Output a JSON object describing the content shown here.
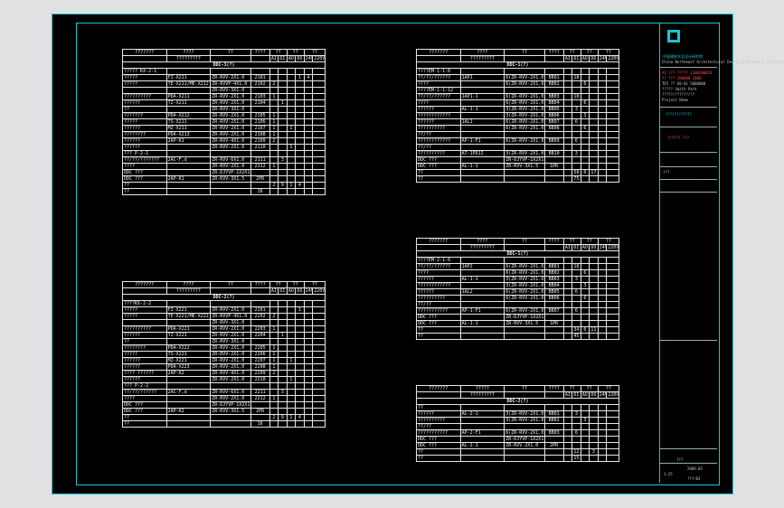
{
  "tables": [
    {
      "id": "ddc-3",
      "header": [
        "???????",
        "????",
        "??",
        "????",
        "??",
        "??",
        "??"
      ],
      "subheader": [
        "",
        "?????????",
        "",
        "",
        "AI",
        "DI",
        "AO",
        "DO",
        "24V",
        "220V"
      ],
      "section": "DDC-3(?)",
      "rows": [
        [
          "????? KX-2-1",
          "",
          "",
          "",
          "",
          "",
          "",
          "",
          "",
          ""
        ],
        [
          "?????",
          "FZ-X211",
          "ZR-RVV-2X1.0",
          "2101",
          "",
          "",
          "",
          "1",
          "4",
          ""
        ],
        [
          "?????",
          "TE-X211/ME-X212",
          "ZR-RVVP-4X1.0",
          "2102",
          "2",
          "",
          "",
          "",
          "",
          ""
        ],
        [
          "",
          "",
          "ZR-RVV-3X1.0",
          "",
          "",
          "",
          "",
          "",
          "",
          ""
        ],
        [
          "??????????",
          "PDA-X211",
          "ZR-RVV-2X1.0",
          "2103",
          "1",
          "",
          "",
          "",
          "",
          ""
        ],
        [
          "??????",
          "TZ-X211",
          "ZR-RVV-2X1.0",
          "2104",
          "",
          "1",
          "",
          "",
          "",
          ""
        ],
        [
          "??",
          "",
          "ZR-RVV-3X1.0",
          "",
          "",
          "",
          "",
          "",
          "",
          ""
        ],
        [
          "???????",
          "PDA-X212",
          "ZR-RVV-2X1.0",
          "2105",
          "1",
          "",
          "",
          "",
          "",
          ""
        ],
        [
          "?????",
          "TS-X211",
          "ZR-RVV-2X1.0",
          "2106",
          "1",
          "",
          "",
          "",
          "",
          ""
        ],
        [
          "??????",
          "MZ-X211",
          "ZR-RVV-2X1.0",
          "2107",
          "1",
          "",
          "1",
          "",
          "",
          ""
        ],
        [
          "????????",
          "PDA-X213",
          "ZR-RVV-2X1.0",
          "2108",
          "1",
          "",
          "",
          "",
          "",
          ""
        ],
        [
          "??????",
          "2AP-K1",
          "ZR-RVV-4X1.0",
          "2109",
          "2",
          "",
          "",
          "",
          "",
          ""
        ],
        [
          "??????",
          "",
          "ZR-RVV-2X1.0",
          "2110",
          "",
          "",
          "1",
          "",
          "",
          ""
        ],
        [
          "??? P-2-1",
          "",
          "",
          "",
          "",
          "",
          "",
          "",
          "",
          ""
        ],
        [
          "??/??/???????",
          "2AC-F,d",
          "ZR-RVV-6X1.0",
          "2111",
          "",
          "3",
          "",
          "",
          "",
          ""
        ],
        [
          "????",
          "",
          "ZR-RVV-2X1.0",
          "2112",
          "1",
          "",
          "",
          "",
          "",
          ""
        ],
        [
          "DDC ???",
          "",
          "ZR-DJYVP-1X2X1.0",
          "",
          "",
          "",
          "",
          "",
          "",
          ""
        ],
        [
          "DDC ???",
          "2AP-K1",
          "ZR-KVV-3X1.5",
          "2PR",
          "",
          "",
          "",
          "",
          "",
          ""
        ],
        [
          "??",
          "",
          "",
          "",
          "2",
          "9",
          "1",
          "4",
          "",
          ""
        ],
        [
          "??",
          "",
          "",
          "16",
          "",
          "",
          "",
          "",
          "",
          ""
        ]
      ]
    },
    {
      "id": "ddc-2",
      "header": [
        "???????",
        "????",
        "??",
        "????",
        "??",
        "??",
        "??"
      ],
      "subheader": [
        "",
        "?????????",
        "",
        "",
        "AI",
        "DI",
        "AO",
        "DO",
        "24V",
        "220V"
      ],
      "section": "DDC-2(?)",
      "rows": [
        [
          "????KX-2-2",
          "",
          "",
          "",
          "",
          "",
          "",
          "",
          "",
          ""
        ],
        [
          "?????",
          "FZ-X221",
          "ZR-RVV-2X1.0",
          "2201",
          "",
          "",
          "",
          "1",
          "",
          ""
        ],
        [
          "?????",
          "TE-X221/ME-X222",
          "ZR-RVVP-4X1.0",
          "2202",
          "2",
          "",
          "",
          "",
          "",
          ""
        ],
        [
          "",
          "",
          "ZR-RVV-3X1.0",
          "",
          "",
          "",
          "",
          "",
          "",
          ""
        ],
        [
          "??????????",
          "PDA-X221",
          "ZR-RVV-2X1.0",
          "2203",
          "1",
          "",
          "",
          "",
          "",
          ""
        ],
        [
          "??????",
          "TZ-X221",
          "ZR-RVV-2X1.0",
          "2204",
          "",
          "1",
          "",
          "",
          "",
          ""
        ],
        [
          "??",
          "",
          "ZR-RVV-3X1.0",
          "",
          "",
          "",
          "",
          "",
          "",
          ""
        ],
        [
          "????????",
          "PDA-X222",
          "ZR-RVV-2X1.0",
          "2205",
          "1",
          "",
          "",
          "",
          "",
          ""
        ],
        [
          "?????",
          "TS-X221",
          "ZR-RVV-2X1.0",
          "2206",
          "1",
          "",
          "",
          "",
          "",
          ""
        ],
        [
          "??????",
          "MZ-X221",
          "ZR-RVV-2X1.0",
          "2207",
          "1",
          "",
          "1",
          "",
          "",
          ""
        ],
        [
          "??????",
          "PDA-X223",
          "ZR-RVV-2X1.0",
          "2208",
          "1",
          "",
          "",
          "",
          "",
          ""
        ],
        [
          "???? ??????",
          "2AP-K2",
          "ZR-RVV-4X1.0",
          "2209",
          "2",
          "",
          "",
          "",
          "",
          ""
        ],
        [
          "??????",
          "",
          "ZR-RVV-2X1.0",
          "2210",
          "",
          "",
          "1",
          "",
          "",
          ""
        ],
        [
          "??? P-2-2",
          "",
          "",
          "",
          "",
          "",
          "",
          "",
          "",
          ""
        ],
        [
          "??/??/??????",
          "2AC-F,d",
          "ZR-RVV-6X1.0",
          "2211",
          "",
          "3",
          "",
          "",
          "",
          ""
        ],
        [
          "????",
          "",
          "ZR-RVV-2X1.0",
          "2212",
          "1",
          "",
          "",
          "",
          "",
          ""
        ],
        [
          "DDC ???",
          "",
          "ZR-DJYVP-1X2X1.0",
          "",
          "",
          "",
          "",
          "",
          "",
          ""
        ],
        [
          "DDC ???",
          "2AP-K2",
          "ZR-KVV-3X1.5",
          "2PR",
          "",
          "",
          "",
          "",
          "",
          ""
        ],
        [
          "??",
          "",
          "",
          "",
          "2",
          "9",
          "1",
          "4",
          "",
          ""
        ],
        [
          "??",
          "",
          "",
          "16",
          "",
          "",
          "",
          "",
          "",
          ""
        ]
      ]
    },
    {
      "id": "ddc-1-top",
      "header": [
        "???????",
        "????",
        "??",
        "????",
        "??",
        "??",
        "??"
      ],
      "subheader": [
        "",
        "?????????",
        "",
        "",
        "AI",
        "DI",
        "AO",
        "DO",
        "24V",
        "220V"
      ],
      "section": "DDC-1(?)",
      "rows": [
        [
          "????EM-1-1-6",
          "",
          "",
          "",
          "",
          "",
          "",
          "",
          "",
          ""
        ],
        [
          "??/??/??????",
          "1AP1",
          "6(ZR-RVV-2X1.0)",
          "BB01",
          "",
          "18",
          "",
          "",
          "",
          ""
        ],
        [
          "????",
          "",
          "6(ZR-RVV-2X1.0)",
          "BB02",
          "",
          "",
          "6",
          "",
          "",
          ""
        ],
        [
          "????EM-1-1-12",
          "",
          "",
          "",
          "",
          "",
          "",
          "",
          "",
          ""
        ],
        [
          "??/??/??????",
          "1AP1-1",
          "6(ZR-RVV-2X1.0)",
          "BB03",
          "",
          "18",
          "",
          "",
          "",
          ""
        ],
        [
          "????",
          "",
          "6(ZR-RVV-2X1.0)",
          "BB04",
          "",
          "",
          "6",
          "",
          "",
          ""
        ],
        [
          "??????",
          "AL-1-1",
          "3(ZR-RVV-2X1.0)",
          "BB05",
          "",
          "3",
          "",
          "",
          "",
          ""
        ],
        [
          "????????????",
          "",
          "3(ZR-RVV-2X1.0)",
          "BB06",
          "",
          "",
          "3",
          "",
          "",
          ""
        ],
        [
          "??????",
          "1AL1",
          "6(ZR-RVV-2X1.0)",
          "BB07",
          "",
          "6",
          "",
          "",
          "",
          ""
        ],
        [
          "??????????",
          "",
          "6(ZR-RVV-2X1.0)",
          "BB08",
          "",
          "",
          "6",
          "",
          "",
          ""
        ],
        [
          "??/??",
          "",
          "",
          "",
          "",
          "",
          "",
          "",
          "",
          ""
        ],
        [
          "????????????",
          "AP-1-F1",
          "6(ZR-RVV-2X1.0)",
          "BB09",
          "",
          "6",
          "",
          "",
          "",
          ""
        ],
        [
          "??/??",
          "",
          "",
          "",
          "",
          "",
          "",
          "",
          "",
          ""
        ],
        [
          "??????????",
          "AT-1PD1I",
          "3(ZR-RVV-2X1.0)",
          "BB10",
          "",
          "3",
          "",
          "",
          "",
          ""
        ],
        [
          "DDC ???",
          "",
          "ZR-DJYVP-1X2X1.0",
          "",
          "",
          "",
          "",
          "",
          "",
          ""
        ],
        [
          "DDC ???",
          "AL-1-1",
          "ZR-RVV-3X1.5",
          "1PR",
          "",
          "",
          "",
          "",
          "",
          ""
        ],
        [
          "??",
          "",
          "",
          "",
          "",
          "58",
          "0",
          "17",
          "",
          ""
        ],
        [
          "??",
          "",
          "",
          "",
          "",
          "75",
          "",
          "",
          "",
          ""
        ]
      ]
    },
    {
      "id": "ddc-1-mid",
      "header": [
        "???????",
        "????",
        "??",
        "????",
        "??",
        "??",
        "??"
      ],
      "subheader": [
        "",
        "?????????",
        "",
        "",
        "AI",
        "DI",
        "AO",
        "DO",
        "24V",
        "220V"
      ],
      "section": "DDC-1(?)",
      "rows": [
        [
          "????EM-2-1-6",
          "",
          "",
          "",
          "",
          "",
          "",
          "",
          "",
          ""
        ],
        [
          "??/??/??????",
          "1AP2",
          "6(ZR-RVV-2X1.0)",
          "BB01",
          "",
          "18",
          "",
          "",
          "",
          ""
        ],
        [
          "????",
          "",
          "6(ZR-RVV-2X1.0)",
          "BB02",
          "",
          "",
          "6",
          "",
          "",
          ""
        ],
        [
          "??????",
          "AL-1-1",
          "3(ZR-RVV-2X1.0)",
          "BB03",
          "",
          "3",
          "",
          "",
          "",
          ""
        ],
        [
          "????????????",
          "",
          "3(ZR-RVV-2X1.0)",
          "BB04",
          "",
          "",
          "3",
          "",
          "",
          ""
        ],
        [
          "??????",
          "1AL2",
          "6(ZR-RVV-2X1.0)",
          "BB05",
          "",
          "6",
          "",
          "",
          "",
          ""
        ],
        [
          "??????????",
          "",
          "6(ZR-RVV-2X1.0)",
          "BB06",
          "",
          "",
          "6",
          "",
          "",
          ""
        ],
        [
          "??/??",
          "",
          "",
          "",
          "",
          "",
          "",
          "",
          "",
          ""
        ],
        [
          "???????????",
          "AP-1-F1",
          "6(ZR-RVV-2X1.0)",
          "BB07",
          "",
          "6",
          "",
          "",
          "",
          ""
        ],
        [
          "DDC ???",
          "",
          "ZR-DJYVP-1X2X1.0",
          "",
          "",
          "",
          "",
          "",
          "",
          ""
        ],
        [
          "DDC ???",
          "AL-1-1",
          "ZR-RVV-3X1.5",
          "1PR",
          "",
          "",
          "",
          "",
          "",
          ""
        ],
        [
          "??",
          "",
          "",
          "",
          "",
          "34",
          "0",
          "11",
          "",
          ""
        ],
        [
          "??",
          "",
          "",
          "",
          "",
          "45",
          "",
          "",
          "",
          ""
        ]
      ]
    },
    {
      "id": "ddc-2-bot",
      "header": [
        "???????",
        "?????",
        "??",
        "????",
        "??",
        "??",
        "??"
      ],
      "subheader": [
        "",
        "?????????",
        "",
        "",
        "AI",
        "DI",
        "AO",
        "DO",
        "24V",
        "220V"
      ],
      "section": "DDC-2(?)",
      "rows": [
        [
          "??",
          "",
          "",
          "",
          "",
          "",
          "",
          "",
          "",
          ""
        ],
        [
          "??????",
          "AL-2-1",
          "3(ZR-RVV-2X1.0)",
          "BB01",
          "",
          "3",
          "",
          "",
          "",
          ""
        ],
        [
          "??????????",
          "",
          "3(ZR-RVV-2X1.0)",
          "BB02",
          "",
          "",
          "3",
          "",
          "",
          ""
        ],
        [
          "??/??",
          "",
          "",
          "",
          "",
          "",
          "",
          "",
          "",
          ""
        ],
        [
          "???????????",
          "AP-2-F1",
          "6(ZR-RVV-2X1.0)",
          "BB03",
          "",
          "6",
          "",
          "",
          "",
          ""
        ],
        [
          "DDC ???",
          "",
          "ZR-DJYVP-1X2X1.0",
          "",
          "",
          "",
          "",
          "",
          "",
          ""
        ],
        [
          "DDC ???",
          "AL-2-1",
          "ZR-RVV-2X1.0",
          "2PR",
          "",
          "",
          "",
          "",
          "",
          ""
        ],
        [
          "??",
          "",
          "",
          "",
          "",
          "12",
          "",
          "3",
          "",
          ""
        ],
        [
          "??",
          "",
          "",
          "",
          "",
          "15",
          "",
          "",
          "",
          ""
        ]
      ]
    }
  ],
  "titleblock": {
    "company": "中国建筑东北设计研究院",
    "company_en": "China Northeast Architectural Design & Research Institute",
    "license": [
      "A1 ??? ????? 2100200010",
      "?? ??? 200000-2000",
      "TD5 ?? 60-01 5000000",
      "????? Smith Park",
      "?????/??????/??",
      "Project Name"
    ],
    "project_name": "????????????",
    "drawing_name": "?????? ???",
    "sheet_label": "???",
    "sheet_no": "???",
    "stage": "???",
    "date": "2009.05",
    "scale": "1:25",
    "drawing_no": "???/03"
  }
}
